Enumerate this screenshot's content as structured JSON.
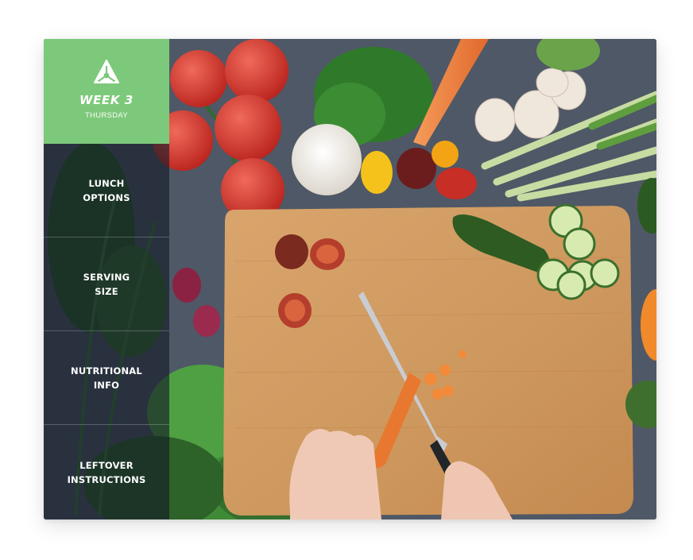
{
  "brand": {
    "logo_icon": "triangle-cutout-logo-icon",
    "week": "WEEK 3",
    "day": "THURSDAY",
    "color": "#7dc97b"
  },
  "menu": {
    "items": [
      {
        "line1": "LUNCH",
        "line2": "OPTIONS"
      },
      {
        "line1": "SERVING",
        "line2": "SIZE"
      },
      {
        "line1": "NUTRITIONAL",
        "line2": "INFO"
      },
      {
        "line1": "LEFTOVER",
        "line2": "INSTRUCTIONS"
      }
    ]
  }
}
